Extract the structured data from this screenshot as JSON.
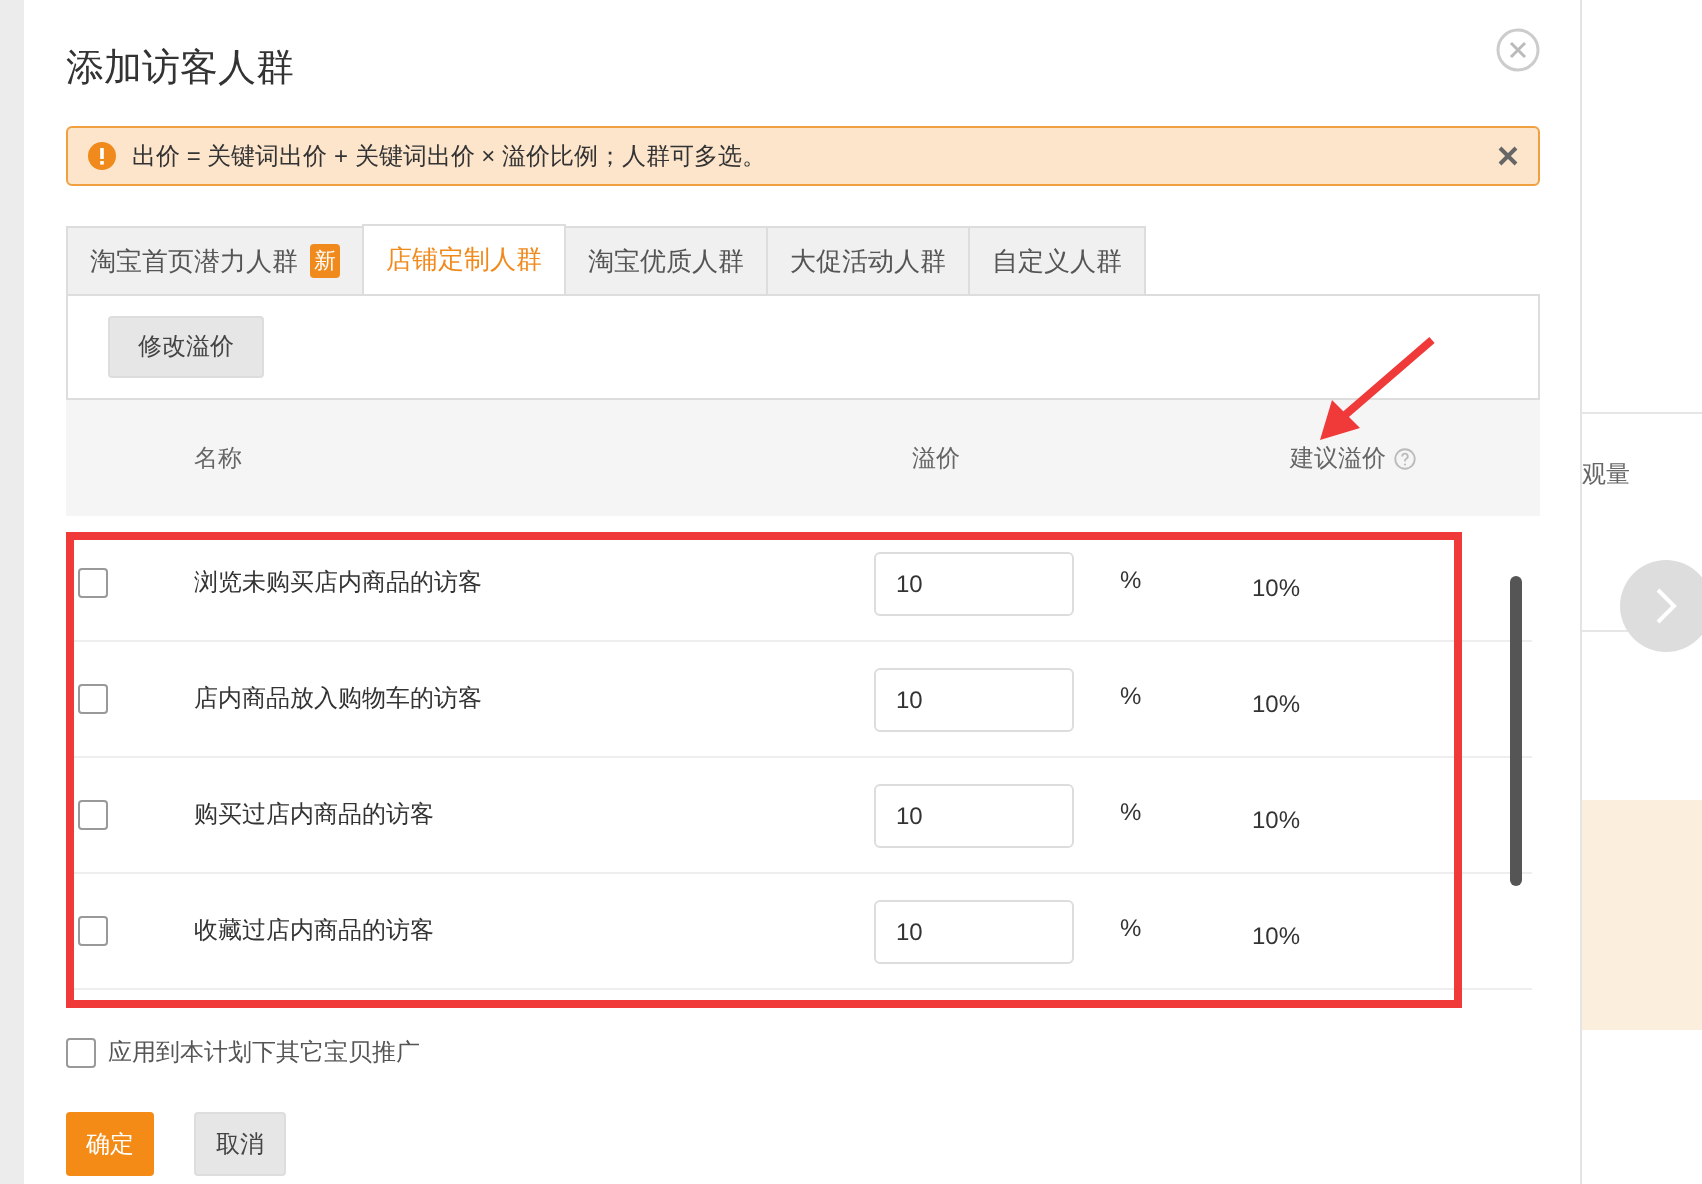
{
  "dialog": {
    "title": "添加访客人群",
    "alert": {
      "text": "出价 = 关键词出价 + 关键词出价 × 溢价比例；人群可多选。"
    },
    "tabs": [
      {
        "label": "淘宝首页潜力人群",
        "badge": "新",
        "selected": false
      },
      {
        "label": "店铺定制人群",
        "selected": true
      },
      {
        "label": "淘宝优质人群",
        "selected": false
      },
      {
        "label": "大促活动人群",
        "selected": false
      },
      {
        "label": "自定义人群",
        "selected": false
      }
    ],
    "edit_button": "修改溢价",
    "table": {
      "columns": [
        "名称",
        "溢价",
        "建议溢价"
      ],
      "rows": [
        {
          "name": "浏览未购买店内商品的访客",
          "checked": false,
          "value": "10",
          "unit": "%",
          "suggested": "10%"
        },
        {
          "name": "店内商品放入购物车的访客",
          "checked": false,
          "value": "10",
          "unit": "%",
          "suggested": "10%"
        },
        {
          "name": "购买过店内商品的访客",
          "checked": false,
          "value": "10",
          "unit": "%",
          "suggested": "10%"
        },
        {
          "name": "收藏过店内商品的访客",
          "checked": false,
          "value": "10",
          "unit": "%",
          "suggested": "10%"
        }
      ]
    },
    "apply_all": {
      "label": "应用到本计划下其它宝贝推广",
      "checked": false
    },
    "buttons": [
      {
        "label": "确定",
        "kind": "primary"
      },
      {
        "label": "取消",
        "kind": "secondary"
      }
    ]
  },
  "background": {
    "text": "观量"
  }
}
